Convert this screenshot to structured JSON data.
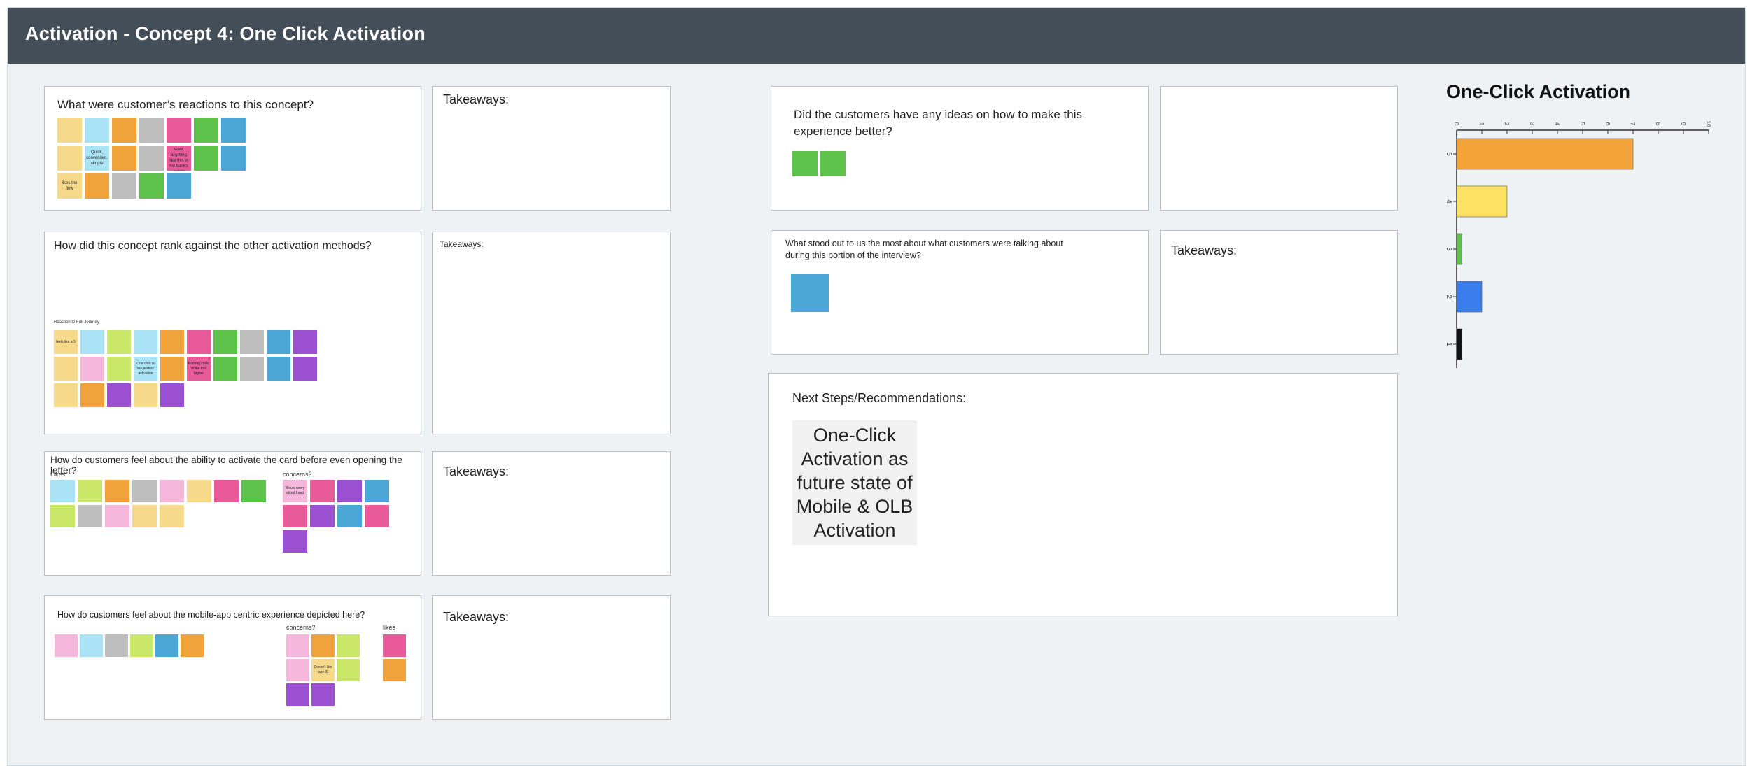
{
  "header": {
    "title": "Activation - Concept 4: One Click Activation"
  },
  "frames": {
    "reactions": {
      "title": "What were customer’s reactions to this concept?"
    },
    "reactions_takeaways": {
      "title": "Takeaways:"
    },
    "rank": {
      "title": "How did this concept rank against the other activation methods?",
      "sublabel": "Reaction to Full Journey"
    },
    "rank_takeaways": {
      "title": "Takeaways:"
    },
    "before_letter": {
      "title": "How do customers feel about the ability to activate the card before even opening the letter?",
      "likes_label": "Likes",
      "concerns_label": "concerns?"
    },
    "before_letter_takeaways": {
      "title": "Takeaways:"
    },
    "mobile_app": {
      "title": "How do customers feel about the mobile-app centric experience depicted here?",
      "concerns_label": "concerns?",
      "likes_label": "likes"
    },
    "mobile_app_takeaways": {
      "title": "Takeaways:"
    },
    "ideas": {
      "title": "Did the customers have any ideas on how to make this experience better?"
    },
    "stood_out": {
      "title": "What stood out to us the most about what customers were talking about during this portion of the interview?"
    },
    "stood_out_takeaways": {
      "title": "Takeaways:"
    },
    "next_steps": {
      "title": "Next Steps/Recommendations:",
      "card": "One-Click Activation as future state of Mobile & OLB Activation"
    }
  },
  "stickies": {
    "reactions": [
      {
        "text": "",
        "color": "#f7d98b"
      },
      {
        "text": "",
        "color": "#a9e3f5"
      },
      {
        "text": "",
        "color": "#f0a33a"
      },
      {
        "text": "",
        "color": "#bdbdbd"
      },
      {
        "text": "",
        "color": "#e85a9a"
      },
      {
        "text": "",
        "color": "#5cc24a"
      },
      {
        "text": "",
        "color": "#4aa7d6"
      },
      {
        "text": "",
        "color": "#f7d98b"
      },
      {
        "text": "Quick, convenient, simple",
        "color": "#a9e3f5"
      },
      {
        "text": "",
        "color": "#f0a33a"
      },
      {
        "text": "",
        "color": "#bdbdbd"
      },
      {
        "text": "Doesn't want anything like this in his bank's mobile",
        "color": "#e85a9a"
      },
      {
        "text": "",
        "color": "#5cc24a"
      },
      {
        "text": "",
        "color": "#4aa7d6"
      },
      {
        "text": "likes the flow",
        "color": "#f7d98b"
      },
      {
        "text": "",
        "color": "#f0a33a"
      },
      {
        "text": "",
        "color": "#bdbdbd"
      },
      {
        "text": "",
        "color": "#5cc24a"
      },
      {
        "text": "",
        "color": "#4aa7d6"
      }
    ],
    "rank": [
      {
        "text": "feels like a 5",
        "color": "#f7d98b"
      },
      {
        "text": "",
        "color": "#a9e3f5"
      },
      {
        "text": "",
        "color": "#c9e86a"
      },
      {
        "text": "",
        "color": "#a9e3f5"
      },
      {
        "text": "",
        "color": "#f0a33a"
      },
      {
        "text": "",
        "color": "#e85a9a"
      },
      {
        "text": "",
        "color": "#5cc24a"
      },
      {
        "text": "",
        "color": "#bdbdbd"
      },
      {
        "text": "",
        "color": "#4aa7d6"
      },
      {
        "text": "",
        "color": "#9b4fd1"
      },
      {
        "text": "",
        "color": "#f7d98b"
      },
      {
        "text": "",
        "color": "#f5b8dc"
      },
      {
        "text": "",
        "color": "#c9e86a"
      },
      {
        "text": "One click is the perfect activation",
        "color": "#a9e3f5"
      },
      {
        "text": "",
        "color": "#f0a33a"
      },
      {
        "text": "Nothing could make this higher",
        "color": "#e85a9a"
      },
      {
        "text": "",
        "color": "#5cc24a"
      },
      {
        "text": "",
        "color": "#bdbdbd"
      },
      {
        "text": "",
        "color": "#4aa7d6"
      },
      {
        "text": "",
        "color": "#9b4fd1"
      },
      {
        "text": "",
        "color": "#f7d98b"
      },
      {
        "text": "",
        "color": "#f0a33a"
      },
      {
        "text": "",
        "color": "#9b4fd1"
      },
      {
        "text": "",
        "color": "#f7d98b"
      },
      {
        "text": "",
        "color": "#9b4fd1"
      }
    ],
    "before_letter_likes": [
      {
        "text": "",
        "color": "#a9e3f5"
      },
      {
        "text": "",
        "color": "#c9e86a"
      },
      {
        "text": "",
        "color": "#f0a33a"
      },
      {
        "text": "",
        "color": "#bdbdbd"
      },
      {
        "text": "",
        "color": "#f5b8dc"
      },
      {
        "text": "",
        "color": "#f7d98b"
      },
      {
        "text": "",
        "color": "#e85a9a"
      },
      {
        "text": "",
        "color": "#5cc24a"
      },
      {
        "text": "",
        "color": "#c9e86a"
      },
      {
        "text": "",
        "color": "#bdbdbd"
      },
      {
        "text": "",
        "color": "#f5b8dc"
      },
      {
        "text": "",
        "color": "#f7d98b"
      },
      {
        "text": "",
        "color": "#f7d98b"
      }
    ],
    "before_letter_concerns": [
      {
        "text": "Would worry about fraud",
        "color": "#f5b8dc"
      },
      {
        "text": "",
        "color": "#e85a9a"
      },
      {
        "text": "",
        "color": "#9b4fd1"
      },
      {
        "text": "",
        "color": "#4aa7d6"
      },
      {
        "text": "",
        "color": "#e85a9a"
      },
      {
        "text": "",
        "color": "#9b4fd1"
      },
      {
        "text": "",
        "color": "#4aa7d6"
      },
      {
        "text": "",
        "color": "#e85a9a"
      },
      {
        "text": "",
        "color": "#9b4fd1"
      }
    ],
    "mobile_app": [
      {
        "text": "",
        "color": "#f5b8dc"
      },
      {
        "text": "",
        "color": "#a9e3f5"
      },
      {
        "text": "",
        "color": "#bdbdbd"
      },
      {
        "text": "",
        "color": "#c9e86a"
      },
      {
        "text": "",
        "color": "#4aa7d6"
      },
      {
        "text": "",
        "color": "#f0a33a"
      }
    ],
    "mobile_app_concerns": [
      {
        "text": "",
        "color": "#f5b8dc"
      },
      {
        "text": "",
        "color": "#f0a33a"
      },
      {
        "text": "",
        "color": "#c9e86a"
      },
      {
        "text": "",
        "color": "#f5b8dc"
      },
      {
        "text": "Doesn't like face ID",
        "color": "#f7d98b"
      },
      {
        "text": "",
        "color": "#c9e86a"
      },
      {
        "text": "",
        "color": "#9b4fd1"
      },
      {
        "text": "",
        "color": "#9b4fd1"
      }
    ],
    "mobile_app_likes": [
      {
        "text": "",
        "color": "#e85a9a"
      },
      {
        "text": "",
        "color": "#f0a33a"
      }
    ],
    "ideas": [
      {
        "text": "",
        "color": "#5cc24a"
      },
      {
        "text": "",
        "color": "#5cc24a"
      }
    ],
    "stood_out": [
      {
        "text": "",
        "color": "#4aa7d6"
      }
    ]
  },
  "chart_data": {
    "type": "bar",
    "title": "One-Click Activation",
    "orientation": "horizontal",
    "categories": [
      "5",
      "4",
      "3",
      "2",
      "1"
    ],
    "values": [
      7,
      2,
      0.2,
      1,
      0.2
    ],
    "colors": [
      "#f2a43a",
      "#fde262",
      "#5cc24a",
      "#3b7deb",
      "#111111"
    ],
    "xlim": [
      0,
      10
    ],
    "xticks": [
      "0",
      "1",
      "2",
      "3",
      "4",
      "5",
      "6",
      "7",
      "8",
      "9",
      "10"
    ]
  }
}
